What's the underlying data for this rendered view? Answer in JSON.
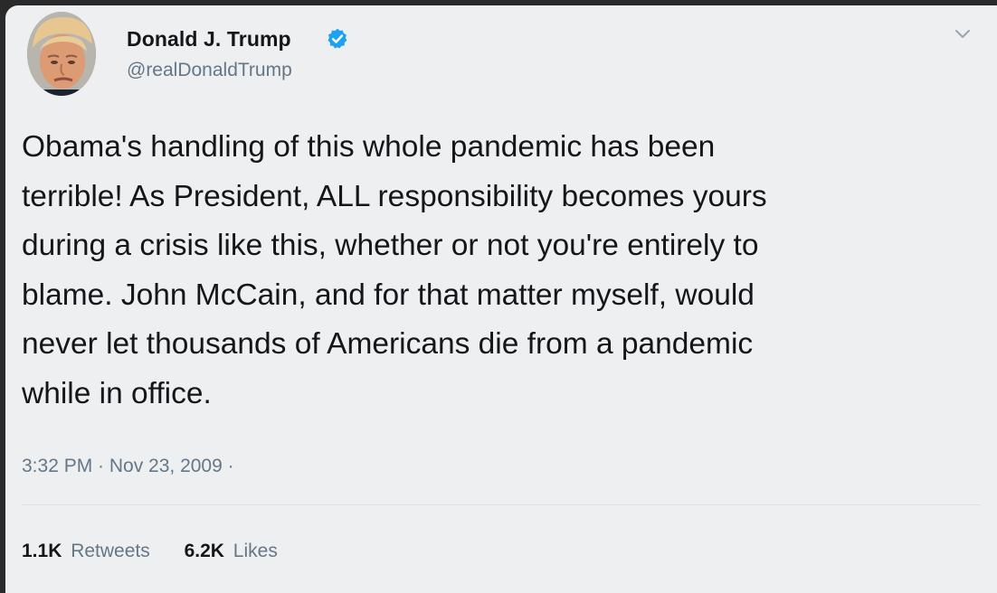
{
  "author": {
    "name": "Donald J. Trump",
    "handle": "@realDonaldTrump",
    "verified": true
  },
  "tweet": {
    "text": "Obama's handling of this whole pandemic has been\nterrible! As President, ALL responsibility becomes yours\nduring a crisis like this, whether or not you're entirely to\nblame. John McCain, and for that matter myself, would\nnever let thousands of Americans die from a pandemic\nwhile in office.",
    "timestamp": "3:32 PM · Nov 23, 2009 ·"
  },
  "stats": {
    "retweets": {
      "count": "1.1K",
      "label": "Retweets"
    },
    "likes": {
      "count": "6.2K",
      "label": "Likes"
    }
  },
  "icons": {
    "verified": "verified-badge-icon",
    "caret": "chevron-down-icon"
  },
  "colors": {
    "card_background": "#eeeff1",
    "text_primary": "#14171a",
    "text_secondary": "#657786",
    "verified_blue": "#1da1f2"
  }
}
